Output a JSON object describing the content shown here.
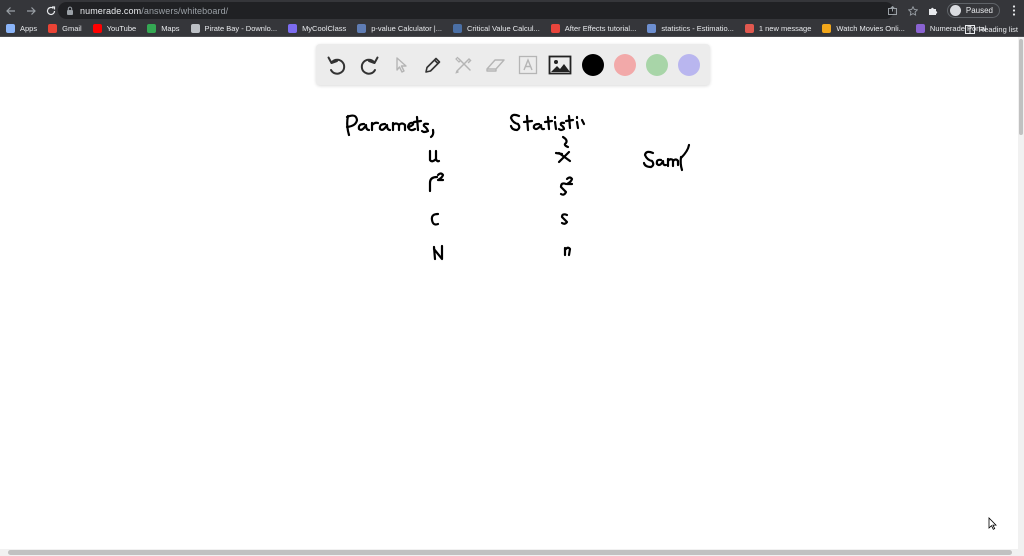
{
  "browser": {
    "url_host": "numerade.com",
    "url_path": "/answers/whiteboard/",
    "profile_label": "Paused",
    "bookmarks": [
      {
        "label": "Apps",
        "icon": "apps-grid-icon",
        "color": "#8ab4f8"
      },
      {
        "label": "Gmail",
        "icon": "gmail-icon",
        "color": "#ea4335"
      },
      {
        "label": "YouTube",
        "icon": "youtube-icon",
        "color": "#ff0000"
      },
      {
        "label": "Maps",
        "icon": "maps-icon",
        "color": "#34a853"
      },
      {
        "label": "Pirate Bay - Downlo...",
        "icon": "monitor-icon",
        "color": "#bdc1c6"
      },
      {
        "label": "MyCoolClass",
        "icon": "mycoolclass-icon",
        "color": "#7c6cf0"
      },
      {
        "label": "p-value Calculator |...",
        "icon": "globe-icon",
        "color": "#5f7db5"
      },
      {
        "label": "Critical Value Calcul...",
        "icon": "globe-icon",
        "color": "#4a6fa5"
      },
      {
        "label": "After Effects tutorial...",
        "icon": "adobe-icon",
        "color": "#e8453c"
      },
      {
        "label": "statistics - Estimatio...",
        "icon": "stackexchange-icon",
        "color": "#6d8fd0"
      },
      {
        "label": "1 new message",
        "icon": "message-icon",
        "color": "#e0584f"
      },
      {
        "label": "Watch Movies Onli...",
        "icon": "movie-icon",
        "color": "#f2a71b"
      },
      {
        "label": "Numerade Portal",
        "icon": "numerade-icon",
        "color": "#8a63d2"
      }
    ],
    "reading_list_label": "Reading list"
  },
  "toolbar": {
    "tools": [
      {
        "name": "undo-icon"
      },
      {
        "name": "redo-icon"
      },
      {
        "name": "select-pointer-icon"
      },
      {
        "name": "pen-icon"
      },
      {
        "name": "tools-crossed-icon"
      },
      {
        "name": "eraser-icon"
      },
      {
        "name": "text-icon"
      },
      {
        "name": "image-icon"
      }
    ],
    "colors": [
      {
        "name": "black",
        "hex": "#000000"
      },
      {
        "name": "pink",
        "hex": "#f2a9a9"
      },
      {
        "name": "green",
        "hex": "#a8d5a8"
      },
      {
        "name": "lavender",
        "hex": "#b9b6ef"
      }
    ]
  },
  "whiteboard": {
    "handwriting": [
      "Parameters",
      "Statistics",
      "Sample",
      "μ",
      "σ²",
      "σ",
      "N",
      "x̄",
      "s²",
      "s",
      "n"
    ]
  }
}
